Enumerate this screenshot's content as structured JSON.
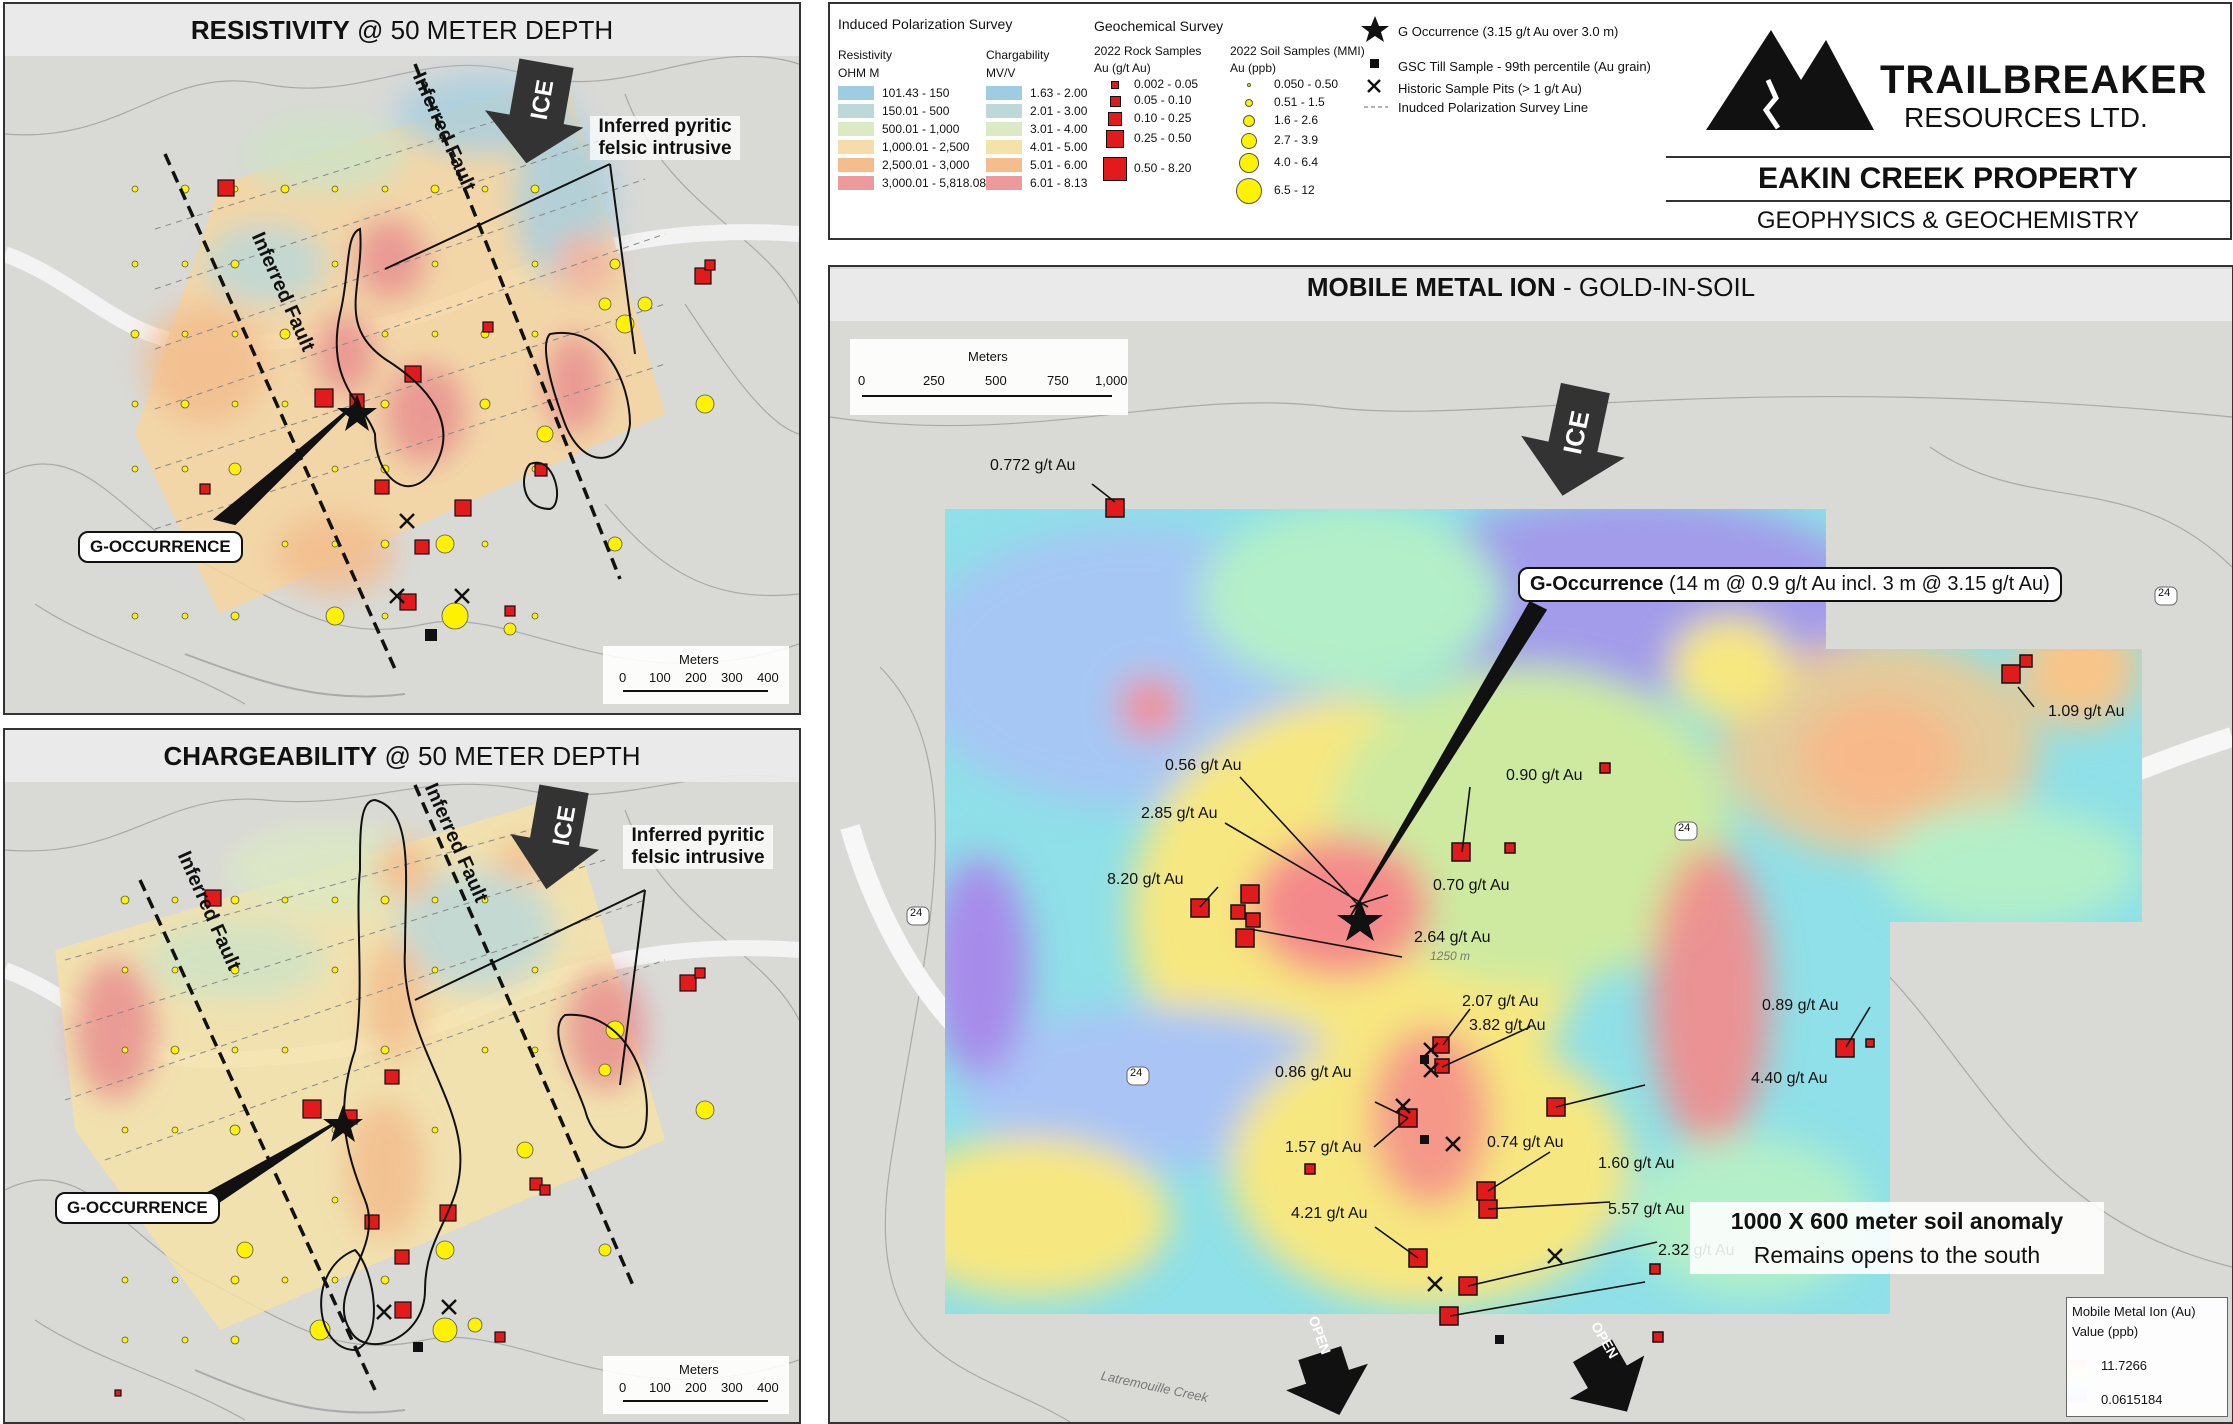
{
  "resistivity_panel": {
    "title_bold": "RESISTIVITY",
    "title_rest": " @ 50 METER DEPTH",
    "fault_label": "Inferred Fault",
    "ice_label": "ICE",
    "intrusive_label": "Inferred pyritic felsic intrusive",
    "g_occurrence_label": "G-OCCURRENCE",
    "scale_title": "Meters",
    "scale_ticks": [
      "0",
      "100",
      "200",
      "300",
      "400"
    ]
  },
  "chargeability_panel": {
    "title_bold": "CHARGEABILITY",
    "title_rest": " @ 50 METER DEPTH",
    "fault_label": "Inferred Fault",
    "ice_label": "ICE",
    "intrusive_label": "Inferred pyritic felsic intrusive",
    "g_occurrence_label": "G-OCCURRENCE",
    "scale_title": "Meters",
    "scale_ticks": [
      "0",
      "100",
      "200",
      "300",
      "400"
    ]
  },
  "legend": {
    "ip_title": "Induced Polarization Survey",
    "resistivity_title": "Resistivity",
    "resistivity_unit": "OHM M",
    "resistivity_classes": [
      {
        "label": "101.43 - 150",
        "color": "#9fcbe3"
      },
      {
        "label": "150.01 - 500",
        "color": "#bcd8d9"
      },
      {
        "label": "500.01 - 1,000",
        "color": "#dbe9c4"
      },
      {
        "label": "1,000.01 - 2,500",
        "color": "#f5dcaa"
      },
      {
        "label": "2,500.01 - 3,000",
        "color": "#f3bd8e"
      },
      {
        "label": "3,000.01 - 5,818.08",
        "color": "#ec9a9a"
      }
    ],
    "chargeability_title": "Chargability",
    "chargeability_unit": "MV/V",
    "chargeability_classes": [
      {
        "label": "1.63 - 2.00",
        "color": "#9fcbe3"
      },
      {
        "label": "2.01 - 3.00",
        "color": "#bcd8d9"
      },
      {
        "label": "3.01 - 4.00",
        "color": "#dbe9c4"
      },
      {
        "label": "4.01 - 5.00",
        "color": "#f5e2a8"
      },
      {
        "label": "5.01 - 6.00",
        "color": "#f3bd8e"
      },
      {
        "label": "6.01 - 8.13",
        "color": "#ec9a9a"
      }
    ],
    "geochem_title": "Geochemical Survey",
    "rock_title": "2022 Rock Samples",
    "rock_unit": "Au (g/t Au)",
    "rock_classes": [
      "0.002 - 0.05",
      "0.05 - 0.10",
      "0.10 - 0.25",
      "0.25 - 0.50",
      "0.50 - 8.20"
    ],
    "soil_title": "2022 Soil Samples (MMI)",
    "soil_unit": "Au (ppb)",
    "soil_classes": [
      "0.050 - 0.50",
      "0.51 - 1.5",
      "1.6 - 2.6",
      "2.7 - 3.9",
      "4.0 - 6.4",
      "6.5 - 12"
    ],
    "symbols": [
      {
        "icon": "star-icon",
        "label": "G Occurrence (3.15 g/t Au over 3.0 m)"
      },
      {
        "icon": "black-square-icon",
        "label": "GSC Till Sample - 99th percentile (Au grain)"
      },
      {
        "icon": "cross-icon",
        "label": "Historic Sample Pits (> 1 g/t Au)"
      },
      {
        "icon": "dashed-line-icon",
        "label": "Inudced Polarization Survey Line"
      }
    ]
  },
  "logo": {
    "company_name": "TRAILBREAKER",
    "company_sub": "RESOURCES LTD.",
    "property": "EAKIN CREEK PROPERTY",
    "subtitle": "GEOPHYSICS & GEOCHEMISTRY"
  },
  "mmi_panel": {
    "title_bold": "MOBILE METAL ION",
    "title_rest": " - GOLD-IN-SOIL",
    "scale_title": "Meters",
    "scale_ticks": [
      "0",
      "250",
      "500",
      "750",
      "1,000"
    ],
    "ice_label": "ICE",
    "open_label": "OPEN",
    "g_occurrence_bold": "G-Occurrence",
    "g_occurrence_detail": " (14 m @ 0.9 g/t Au incl. 3 m @ 3.15 g/t Au)",
    "sample_labels": [
      "0.772 g/t Au",
      "1.09 g/t Au",
      "0.56 g/t Au",
      "0.90 g/t Au",
      "2.85 g/t Au",
      "8.20 g/t Au",
      "0.70 g/t Au",
      "2.64 g/t Au",
      "0.89 g/t Au",
      "2.07 g/t Au",
      "3.82 g/t Au",
      "4.40 g/t Au",
      "0.86 g/t Au",
      "1.57 g/t Au",
      "0.74 g/t Au",
      "1.60 g/t Au",
      "5.57 g/t Au",
      "4.21 g/t Au",
      "2.32 g/t Au"
    ],
    "anomaly_line1": "1000 X 600 meter soil anomaly",
    "anomaly_line2": "Remains opens to the south",
    "colorbar_title": "Mobile Metal Ion (Au)",
    "colorbar_unit": "Value (ppb)",
    "colorbar_max": "11.7266",
    "colorbar_min": "0.0615184",
    "road_label": "24",
    "contour_label": "1250 m",
    "creek_label": "Latremouille Creek"
  }
}
